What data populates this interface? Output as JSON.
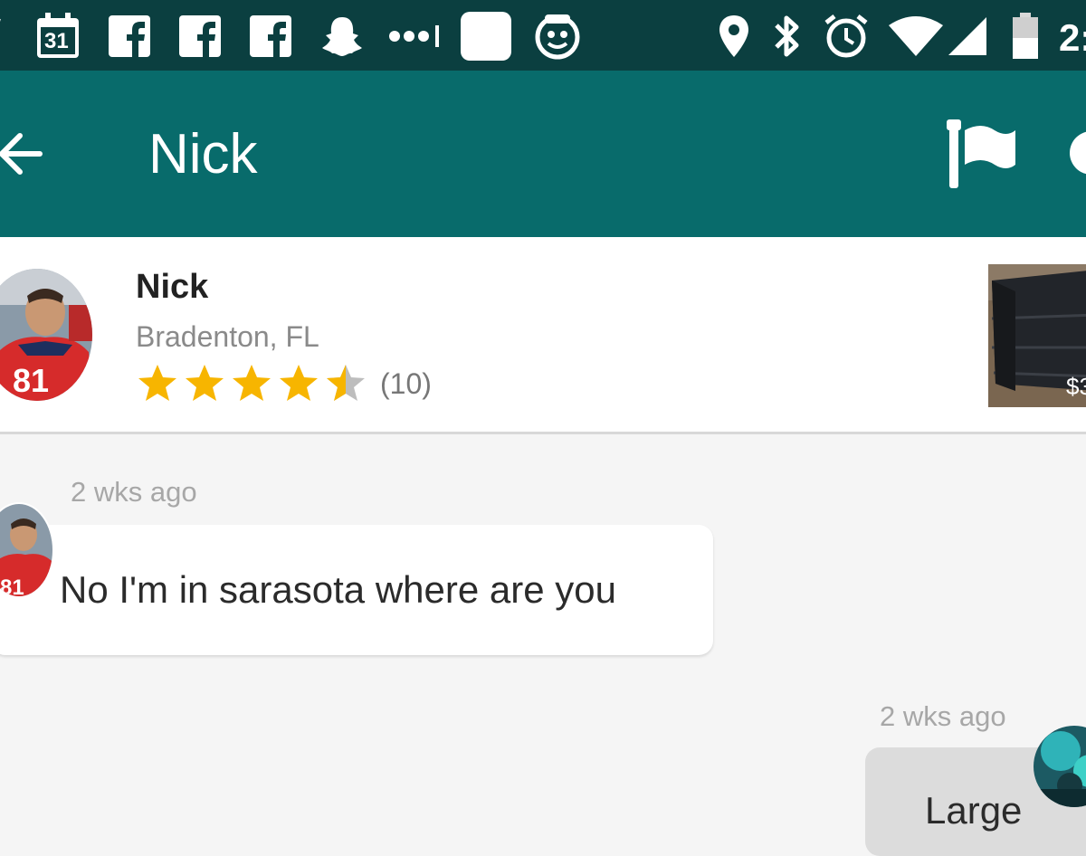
{
  "status_bar": {
    "calendar_date": "31",
    "time": "2:",
    "icons": [
      "partial-icon",
      "calendar-icon",
      "facebook-icon",
      "facebook-icon",
      "facebook-icon",
      "snapchat-icon",
      "more-dots-icon",
      "app-square-icon",
      "app-face-icon",
      "location-icon",
      "bluetooth-icon",
      "alarm-icon",
      "wifi-icon",
      "signal-icon",
      "battery-icon"
    ]
  },
  "app_bar": {
    "title": "Nick",
    "color": "#086b6b",
    "icons": [
      "back-arrow-icon",
      "flag-icon",
      "more-icon"
    ]
  },
  "profile": {
    "name": "Nick",
    "location": "Bradenton, FL",
    "rating": 4.5,
    "rating_max": 5,
    "rating_count": "(10)",
    "listing_price": "$3"
  },
  "messages": [
    {
      "direction": "incoming",
      "time": "2 wks ago",
      "text": "No I'm in sarasota where are you"
    },
    {
      "direction": "outgoing",
      "time": "2 wks ago",
      "text": "Large"
    }
  ],
  "colors": {
    "status_bar": "#0b3f40",
    "star": "#f7b500",
    "star_empty": "#bdbdbd"
  }
}
